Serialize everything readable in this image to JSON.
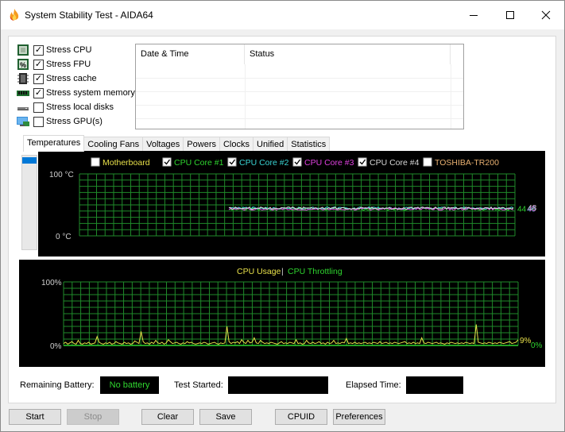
{
  "window": {
    "title": "System Stability Test - AIDA64",
    "controls": {
      "minimize": "—",
      "maximize": "☐",
      "close": "✕"
    }
  },
  "stress_options": [
    {
      "label": "Stress CPU",
      "checked": true,
      "icon": "cpu-icon"
    },
    {
      "label": "Stress FPU",
      "checked": true,
      "icon": "fpu-icon"
    },
    {
      "label": "Stress cache",
      "checked": true,
      "icon": "cache-icon"
    },
    {
      "label": "Stress system memory",
      "checked": true,
      "icon": "memory-icon"
    },
    {
      "label": "Stress local disks",
      "checked": false,
      "icon": "disk-icon"
    },
    {
      "label": "Stress GPU(s)",
      "checked": false,
      "icon": "gpu-icon"
    }
  ],
  "log_table": {
    "columns": [
      "Date & Time",
      "Status"
    ],
    "rows": []
  },
  "tabs": [
    "Temperatures",
    "Cooling Fans",
    "Voltages",
    "Powers",
    "Clocks",
    "Unified",
    "Statistics"
  ],
  "active_tab": "Temperatures",
  "temperature_graph": {
    "y_max_label": "100",
    "y_min_label": "0",
    "unit": "°C",
    "legend": [
      {
        "label": "Motherboard",
        "checked": false,
        "color": "#e8e04a"
      },
      {
        "label": "CPU Core #1",
        "checked": true,
        "color": "#2fd52f"
      },
      {
        "label": "CPU Core #2",
        "checked": true,
        "color": "#3ad6d6"
      },
      {
        "label": "CPU Core #3",
        "checked": true,
        "color": "#e040e0"
      },
      {
        "label": "CPU Core #4",
        "checked": true,
        "color": "#d8d8d8"
      },
      {
        "label": "TOSHIBA-TR200",
        "checked": false,
        "color": "#e8b070"
      }
    ],
    "current_values": [
      {
        "value": "44",
        "color": "#2fd52f"
      },
      {
        "value": "46",
        "color": "#3ad6d6"
      },
      {
        "value": "45",
        "color": "#e040e0"
      },
      {
        "value": "48",
        "color": "#d8d8d8"
      }
    ],
    "level_percent": 44
  },
  "cpu_graph": {
    "legend": [
      {
        "label": "CPU Usage",
        "color": "#e8e04a"
      },
      {
        "label": "CPU Throttling",
        "color": "#2fd52f"
      }
    ],
    "separator": "|",
    "y_max_label": "100%",
    "y_min_label": "0%",
    "current_usage": "9%",
    "current_throttling": "0%",
    "usage_samples": [
      3,
      5,
      2,
      4,
      6,
      3,
      2,
      8,
      3,
      2,
      4,
      3,
      5,
      2,
      3,
      4,
      14,
      5,
      3,
      2,
      4,
      3,
      5,
      2,
      3,
      6,
      4,
      3,
      2,
      5,
      3,
      4,
      2,
      3,
      7,
      5,
      3,
      22,
      6,
      3,
      4,
      2,
      5,
      3,
      8,
      4,
      3,
      5,
      2,
      4,
      9,
      6,
      3,
      4,
      5,
      3,
      2,
      4,
      3,
      6,
      4,
      5,
      3,
      2,
      3,
      4,
      3,
      5,
      4,
      2,
      3,
      4,
      5,
      3,
      2,
      4,
      3,
      4,
      30,
      6,
      3,
      5,
      4,
      6,
      3,
      9,
      5,
      3,
      8,
      4,
      5,
      12,
      4,
      3,
      8,
      5,
      3,
      4,
      3,
      5,
      4,
      3,
      2,
      4,
      6,
      3,
      4,
      3,
      5,
      4,
      3,
      9,
      3,
      4,
      2,
      3,
      8,
      4,
      3,
      5,
      3,
      4,
      6,
      3,
      4,
      2,
      5,
      3,
      4,
      8,
      3,
      4,
      3,
      5,
      4,
      11,
      3,
      4,
      3,
      5,
      3,
      4,
      3,
      4,
      5,
      3,
      4,
      3,
      5,
      4,
      3,
      6,
      3,
      4,
      5,
      3,
      4,
      3,
      5,
      4,
      3,
      4,
      5,
      6,
      3,
      4,
      3,
      5,
      3,
      4,
      3,
      12,
      4,
      3,
      5,
      4,
      3,
      4,
      5,
      3,
      4,
      3,
      2,
      4,
      3,
      5,
      4,
      3,
      4,
      3,
      4,
      3,
      5,
      4,
      3,
      4,
      3,
      33,
      5,
      4,
      3,
      4,
      3,
      5,
      4,
      3,
      4,
      3,
      5,
      4,
      3,
      4,
      5,
      6,
      3,
      4,
      5,
      9
    ]
  },
  "status_bar": {
    "battery_label": "Remaining Battery:",
    "battery_value": "No battery",
    "test_started_label": "Test Started:",
    "test_started_value": "",
    "elapsed_label": "Elapsed Time:",
    "elapsed_value": ""
  },
  "buttons": {
    "start": "Start",
    "stop": "Stop",
    "clear": "Clear",
    "save": "Save",
    "cpuid": "CPUID",
    "preferences": "Preferences"
  }
}
